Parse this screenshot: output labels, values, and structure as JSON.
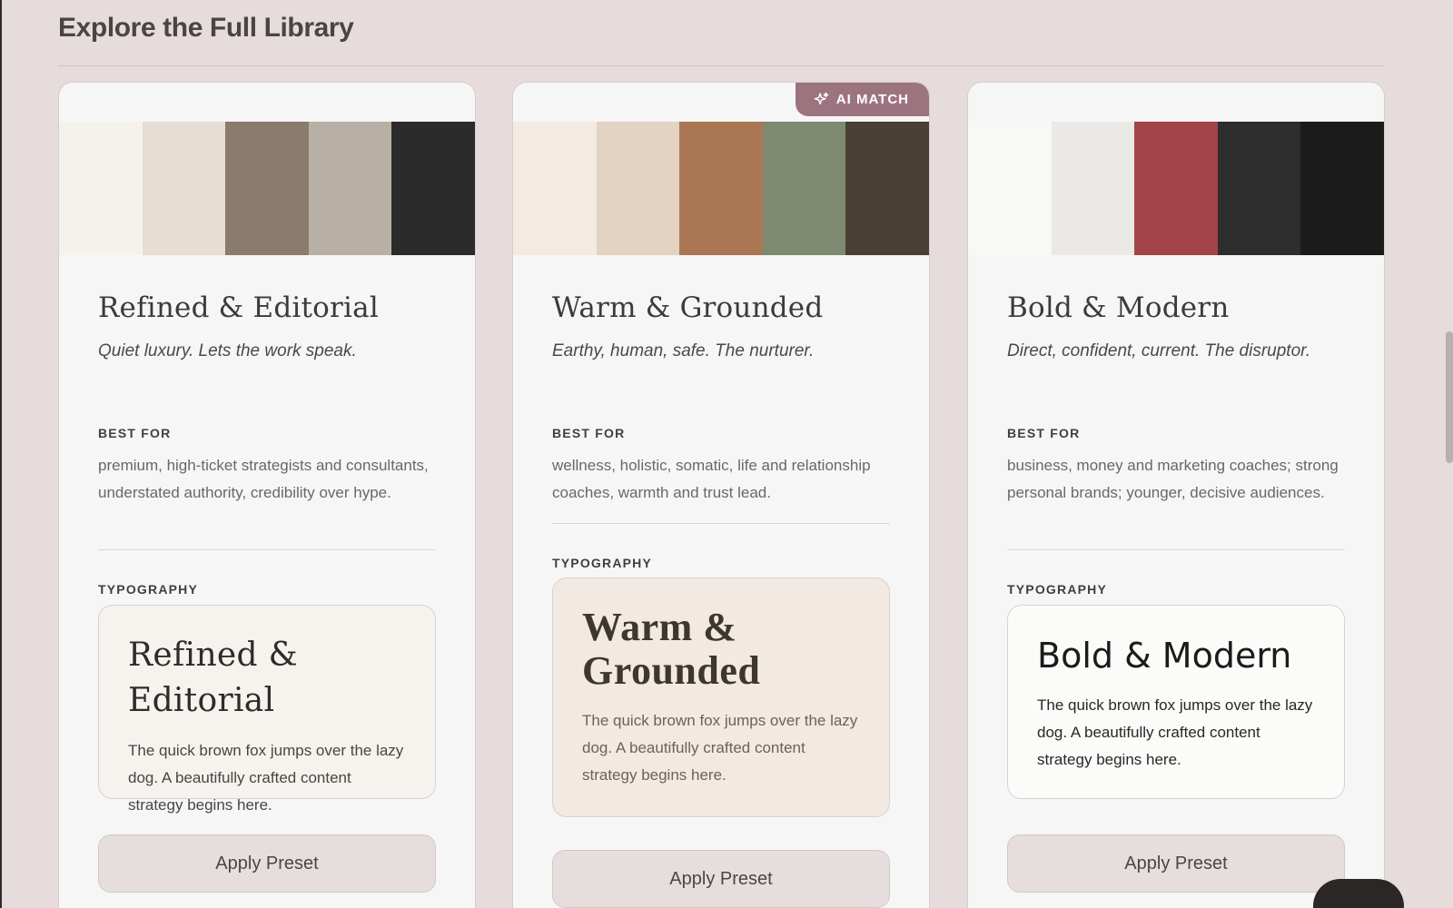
{
  "section": {
    "title": "Explore the Full Library"
  },
  "labels": {
    "best_for": "BEST FOR",
    "typography": "TYPOGRAPHY"
  },
  "badge": {
    "text": "AI MATCH",
    "icon": "sparkles-icon",
    "color": "#9c7480"
  },
  "typography_sample_body": "The quick brown fox jumps over the lazy dog. A beautifully crafted content strategy begins here.",
  "cards": [
    {
      "name": "Refined & Editorial",
      "tagline": "Quiet luxury. Lets the work speak.",
      "best_for": "premium, high-ticket strategists and consultants, understated authority, credibility over hype.",
      "typography_heading": "Refined & Editorial",
      "swatches": [
        "#f5f1ec",
        "#e6ddd3",
        "#8a7b6c",
        "#b9b0a5",
        "#2b2b2b"
      ],
      "button": "Apply Preset",
      "ai_match": false
    },
    {
      "name": "Warm & Grounded",
      "tagline": "Earthy, human, safe. The nurturer.",
      "best_for": "wellness, holistic, somatic, life and relationship coaches, warmth and trust lead.",
      "typography_heading": "Warm & Grounded",
      "swatches": [
        "#f4eae1",
        "#e2d3c2",
        "#ab7654",
        "#7d8a70",
        "#4a3f35"
      ],
      "button": "Apply Preset",
      "ai_match": true
    },
    {
      "name": "Bold & Modern",
      "tagline": "Direct, confident, current. The disruptor.",
      "best_for": "business, money and marketing coaches; strong personal brands; younger, decisive audiences.",
      "typography_heading": "Bold & Modern",
      "swatches": [
        "#f8f8f7",
        "#ebe9e6",
        "#a3434a",
        "#2d2d2d",
        "#1b1b1b"
      ],
      "button": "Apply Preset",
      "ai_match": false
    }
  ]
}
